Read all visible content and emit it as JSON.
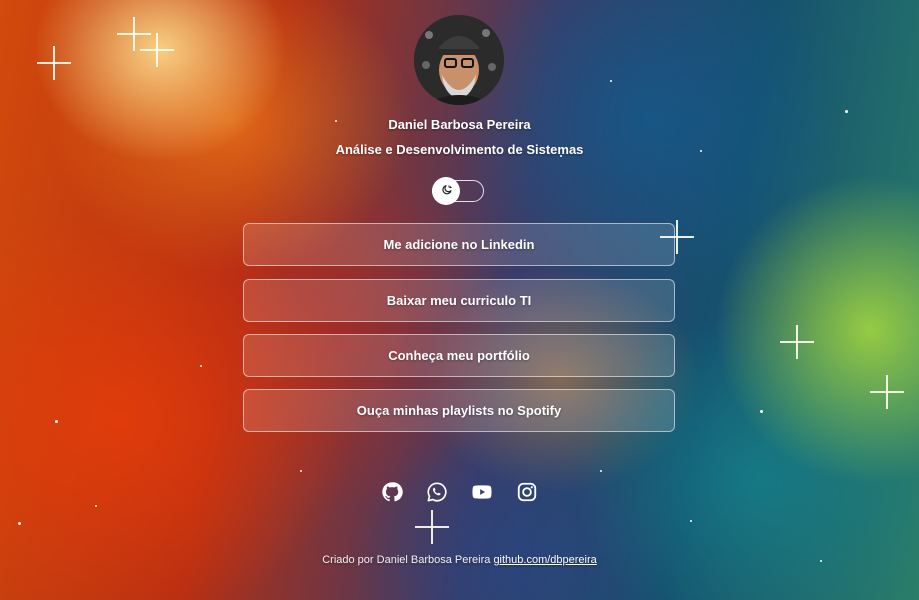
{
  "profile": {
    "name": "Daniel Barbosa Pereira",
    "role": "Análise e Desenvolvimento de Sistemas"
  },
  "theme_toggle": {
    "icon": "moon-sun-icon",
    "state": "off"
  },
  "links": [
    {
      "label": "Me adicione no Linkedin"
    },
    {
      "label": "Baixar meu curriculo TI"
    },
    {
      "label": "Conheça meu portfólio"
    },
    {
      "label": "Ouça minhas playlists no Spotify"
    }
  ],
  "socials": [
    {
      "icon": "github-icon"
    },
    {
      "icon": "whatsapp-icon"
    },
    {
      "icon": "youtube-icon"
    },
    {
      "icon": "instagram-icon"
    }
  ],
  "footer": {
    "text": "Criado por Daniel Barbosa Pereira",
    "link_text": "github.com/dbpereira"
  },
  "colors": {
    "text": "#ffffff",
    "button_border": "rgba(255,255,255,0.55)",
    "button_fill": "rgba(255,255,255,0.14)"
  }
}
